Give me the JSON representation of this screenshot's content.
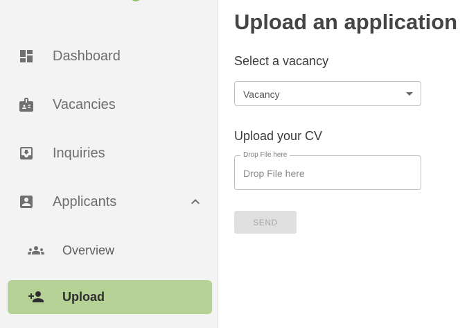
{
  "sidebar": {
    "items": [
      {
        "label": "Dashboard",
        "icon": "dashboard-icon"
      },
      {
        "label": "Vacancies",
        "icon": "badge-icon"
      },
      {
        "label": "Inquiries",
        "icon": "inbox-download-icon"
      },
      {
        "label": "Applicants",
        "icon": "account-box-icon",
        "expanded": true
      }
    ],
    "subitems": [
      {
        "label": "Overview",
        "icon": "people-icon"
      },
      {
        "label": "Upload",
        "icon": "person-add-icon",
        "active": true
      }
    ]
  },
  "main": {
    "title": "Upload an application",
    "vacancy_section": {
      "label": "Select a vacancy",
      "select_value": "Vacancy"
    },
    "cv_section": {
      "label": "Upload your CV",
      "floating_label": "Drop File here",
      "placeholder": "Drop File here"
    },
    "send_label": "SEND"
  },
  "colors": {
    "sidebar_bg": "#f3f3f3",
    "active_bg": "#b5d195",
    "accent_green": "#8fc16b",
    "icon_gray": "#707070"
  }
}
